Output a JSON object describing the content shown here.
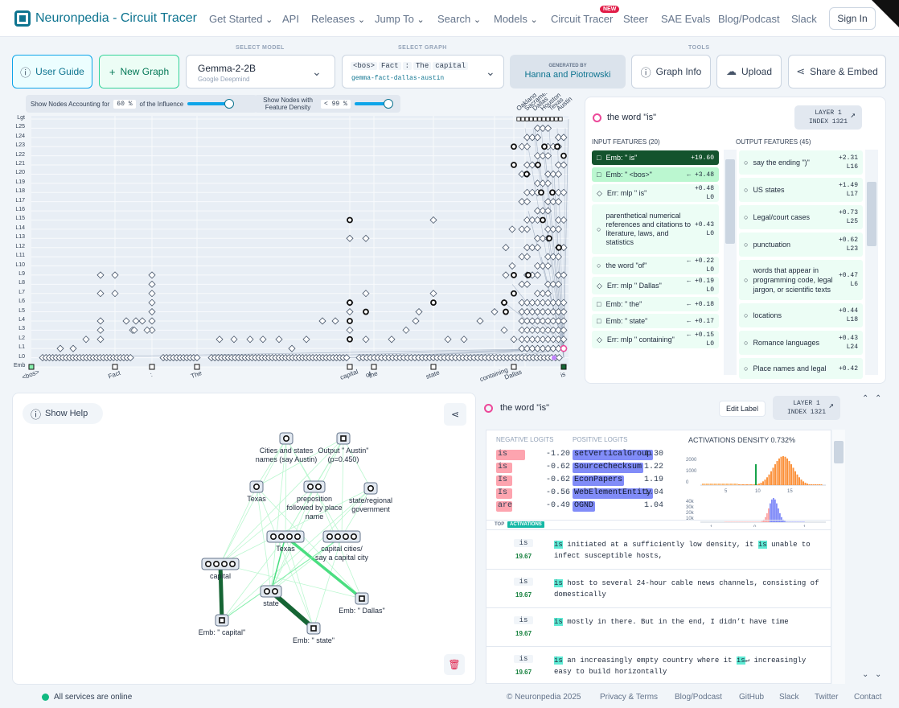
{
  "app": {
    "title": "Neuronpedia - Circuit Tracer"
  },
  "nav": {
    "items": [
      "Get Started",
      "API",
      "Releases",
      "Jump To",
      "Search",
      "Models",
      "Circuit Tracer",
      "Steer",
      "SAE Evals",
      "Blog/Podcast",
      "Slack"
    ],
    "new_badge": "NEW",
    "signin": "Sign In"
  },
  "toolbar": {
    "select_model_label": "SELECT MODEL",
    "select_graph_label": "SELECT GRAPH",
    "tools_label": "TOOLS",
    "user_guide": "User Guide",
    "new_graph": "New Graph",
    "model_name": "Gemma-2-2B",
    "model_org": "Google Deepmind",
    "graph_tokens": [
      "<bos>",
      "Fact",
      ":",
      "The",
      "capital"
    ],
    "graph_slug": "gemma-fact-dallas-austin",
    "generated_by_label": "GENERATED BY",
    "generated_by": "Hanna and Piotrowski",
    "graph_info": "Graph Info",
    "upload": "Upload",
    "share": "Share & Embed"
  },
  "graph_controls": {
    "influence_label_a": "Show Nodes Accounting for",
    "influence_value": "60",
    "influence_unit": "%",
    "influence_label_b": "of the Influence",
    "density_label": "Show Nodes with Feature Density",
    "density_value": "99",
    "density_prefix": "<",
    "density_unit": "%"
  },
  "layers": [
    "Lgt",
    "L25",
    "L24",
    "L23",
    "L22",
    "L21",
    "L20",
    "L19",
    "L18",
    "L17",
    "L16",
    "L15",
    "L14",
    "L13",
    "L12",
    "L11",
    "L10",
    "L9",
    "L8",
    "L7",
    "L6",
    "L5",
    "L4",
    "L3",
    "L2",
    "L1",
    "L0",
    "Emb"
  ],
  "prompt_tokens": [
    "<bos>",
    "Fact",
    ":",
    "The",
    "capital",
    "of",
    "the",
    "state",
    "containing",
    "Dallas",
    "is"
  ],
  "logit_tokens": [
    "Oakland",
    "Sacramento",
    "Dallas",
    "Houston",
    "Texas",
    "Austin"
  ],
  "node_panel": {
    "title": "the word \"is\"",
    "layer": "LAYER 1",
    "index": "INDEX 1321",
    "input_header": "INPUT FEATURES (20)",
    "output_header": "OUTPUT FEATURES (45)",
    "inputs": [
      {
        "label": "Emb: \" is\"",
        "value": "+19.60"
      },
      {
        "label": "Emb: \" <bos>\"",
        "value": "← +3.48"
      },
      {
        "label": "Err: mlp \" is\"",
        "value": "+0.48",
        "layer": "L0"
      },
      {
        "label": "parenthetical numerical references and citations to literature, laws, and statistics",
        "value": "+0.43",
        "layer": "L0"
      },
      {
        "label": "the word \"of\"",
        "value": "← +0.22",
        "layer": "L0"
      },
      {
        "label": "Err: mlp \" Dallas\"",
        "value": "← +0.19",
        "layer": "L0"
      },
      {
        "label": "Emb: \" the\"",
        "value": "← +0.18"
      },
      {
        "label": "Emb: \" state\"",
        "value": "← +0.17"
      },
      {
        "label": "Err: mlp \" containing\"",
        "value": "← +0.15",
        "layer": "L0"
      }
    ],
    "outputs": [
      {
        "label": "say the ending \")\"",
        "value": "+2.31",
        "layer": "L16"
      },
      {
        "label": "US states",
        "value": "+1.49",
        "layer": "L17"
      },
      {
        "label": "Legal/court cases",
        "value": "+0.73",
        "layer": "L25"
      },
      {
        "label": "punctuation",
        "value": "+0.62",
        "layer": "L23"
      },
      {
        "label": "words that appear in programming code, legal jargon, or scientific texts",
        "value": "+0.47",
        "layer": "L6"
      },
      {
        "label": "locations",
        "value": "+0.44",
        "layer": "L18"
      },
      {
        "label": "Romance languages",
        "value": "+0.43",
        "layer": "L24"
      },
      {
        "label": "Place names and legal",
        "value": "+0.42"
      }
    ]
  },
  "subgraph": {
    "show_help": "Show Help",
    "nodes": [
      "Cities and states names (say Austin)",
      "Output \" Austin\" (p=0.450)",
      "Texas",
      "preposition followed by place name",
      "state/regional government",
      "Texas",
      "capital cities/ say a capital city",
      "capital",
      "state",
      "Emb: \" Dallas\"",
      "Emb: \" capital\"",
      "Emb: \" state\""
    ]
  },
  "feature_detail": {
    "title": "the word \"is\"",
    "edit_label": "Edit Label",
    "layer": "LAYER 1",
    "index": "INDEX 1321",
    "neg_header": "NEGATIVE LOGITS",
    "pos_header": "POSITIVE LOGITS",
    "density_header": "ACTIVATIONS DENSITY 0.732%",
    "neg": [
      {
        "tok": "is",
        "v": "-1.20"
      },
      {
        "tok": "is",
        "v": "-0.62"
      },
      {
        "tok": "Is",
        "v": "-0.62"
      },
      {
        "tok": "Is",
        "v": "-0.56"
      },
      {
        "tok": "are",
        "v": "-0.49"
      }
    ],
    "pos": [
      {
        "tok": "setVerticalGroup",
        "v": "1.30"
      },
      {
        "tok": "SourceChecksum",
        "v": "1.22"
      },
      {
        "tok": "EconPapers",
        "v": "1.19"
      },
      {
        "tok": "WebElementEntity",
        "v": "1.04"
      },
      {
        "tok": "OGND",
        "v": "1.04"
      }
    ],
    "density_ticks_a": [
      "2000",
      "1000",
      "0",
      "5",
      "10",
      "15"
    ],
    "density_ticks_b": [
      "40k",
      "30k",
      "20k",
      "10k",
      "0",
      "-1",
      "0",
      "1"
    ],
    "top_label": "TOP",
    "activations_label": "ACTIVATIONS",
    "rows": [
      {
        "tok": "is",
        "val": "19.67",
        "pre": "",
        "hl": "is",
        "post": " initiated at a sufficiently low density, it ",
        "hl2": "is",
        "post2": " unable to infect susceptible hosts,"
      },
      {
        "tok": "is",
        "val": "19.67",
        "pre": "",
        "hl": "is",
        "post": " host to several 24-hour cable news channels, consisting of domestically",
        "hl2": "",
        "post2": ""
      },
      {
        "tok": "is",
        "val": "19.67",
        "pre": "",
        "hl": "is",
        "post": " mostly in there. But in the end, I didn’t have time",
        "hl2": "",
        "post2": ""
      },
      {
        "tok": "is",
        "val": "19.67",
        "pre": "",
        "hl": "is",
        "post": " an increasingly empty country where it ",
        "hl2": "is",
        "post2": "↵ increasingly easy to build horizontally"
      }
    ]
  },
  "status": {
    "online": "All services are online"
  },
  "footer": {
    "items": [
      "© Neuronpedia 2025",
      "Privacy & Terms",
      "Blog/Podcast",
      "GitHub",
      "Slack",
      "Twitter",
      "Contact"
    ]
  }
}
